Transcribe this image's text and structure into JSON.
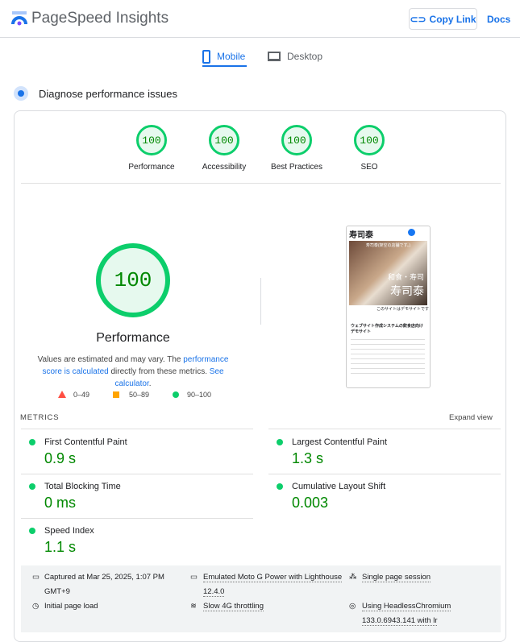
{
  "header": {
    "title": "PageSpeed Insights",
    "copy_link": "Copy Link",
    "docs": "Docs"
  },
  "tabs": [
    {
      "label": "Mobile",
      "active": true
    },
    {
      "label": "Desktop",
      "active": false
    }
  ],
  "section_title": "Diagnose performance issues",
  "categories": [
    {
      "label": "Performance",
      "score": "100"
    },
    {
      "label": "Accessibility",
      "score": "100"
    },
    {
      "label": "Best Practices",
      "score": "100"
    },
    {
      "label": "SEO",
      "score": "100"
    }
  ],
  "main_score": {
    "score": "100",
    "label": "Performance",
    "note_1": "Values are estimated and may vary. The ",
    "link_1": "performance score is calculated",
    "note_2": " directly from these metrics. ",
    "link_2": "See calculator",
    "note_3": "."
  },
  "legend": [
    {
      "range": "0–49",
      "color": "#ff4e42"
    },
    {
      "range": "50–89",
      "color": "#ffa400"
    },
    {
      "range": "90–100",
      "color": "#0cce6b"
    }
  ],
  "screenshot": {
    "logo": "寿司泰",
    "banner": "寿司泰(架空の店舗です。)",
    "hero_1": "和食・寿司",
    "hero_2": "寿司泰",
    "caption": "このサイトはデモサイトです",
    "heading": "ウェブサイト作成システムの飲食店向けデモサイト"
  },
  "metrics": {
    "label": "METRICS",
    "expand": "Expand view",
    "items": [
      {
        "name": "First Contentful Paint",
        "value": "0.9 s"
      },
      {
        "name": "Largest Contentful Paint",
        "value": "1.3 s"
      },
      {
        "name": "Total Blocking Time",
        "value": "0 ms"
      },
      {
        "name": "Cumulative Layout Shift",
        "value": "0.003"
      },
      {
        "name": "Speed Index",
        "value": "1.1 s"
      }
    ]
  },
  "footer": {
    "captured_1": "Captured at Mar 25, 2025, 1:07 PM",
    "captured_2": "GMT+9",
    "emulated_1": "Emulated Moto G Power with Lighthouse",
    "emulated_2": "12.4.0",
    "session": "Single page session",
    "load": "Initial page load",
    "throttling": "Slow 4G throttling",
    "browser_1": "Using HeadlessChromium",
    "browser_2": "133.0.6943.141 with lr"
  }
}
